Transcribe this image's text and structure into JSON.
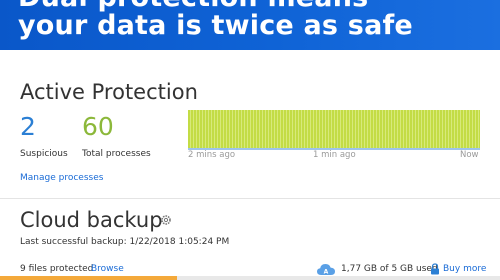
{
  "header": {
    "line1": "Dual protection means",
    "line2": "your data is twice as safe"
  },
  "active_protection": {
    "title": "Active Protection",
    "suspicious_count": "2",
    "suspicious_label": "Suspicious",
    "total_processes": "60",
    "total_processes_label": "Total processes",
    "timeline": {
      "labels": [
        "2 mins ago",
        "1 min ago",
        "Now"
      ]
    },
    "manage_link": "Manage processes",
    "colors": {
      "suspicious": "#2b7fd4",
      "total": "#8cb83a",
      "activity": "#c3dc45"
    }
  },
  "cloud_backup": {
    "title": "Cloud backup",
    "last_backup": "Last successful backup: 1/22/2018 1:05:24 PM",
    "files_protected": "9 files protected",
    "browse_link": "Browse",
    "storage_used": "1,77 GB of 5 GB used",
    "storage_fraction": 0.354,
    "buy_more_link": "Buy more",
    "icons": [
      "gear-icon",
      "cloud-icon",
      "lock-icon"
    ]
  }
}
